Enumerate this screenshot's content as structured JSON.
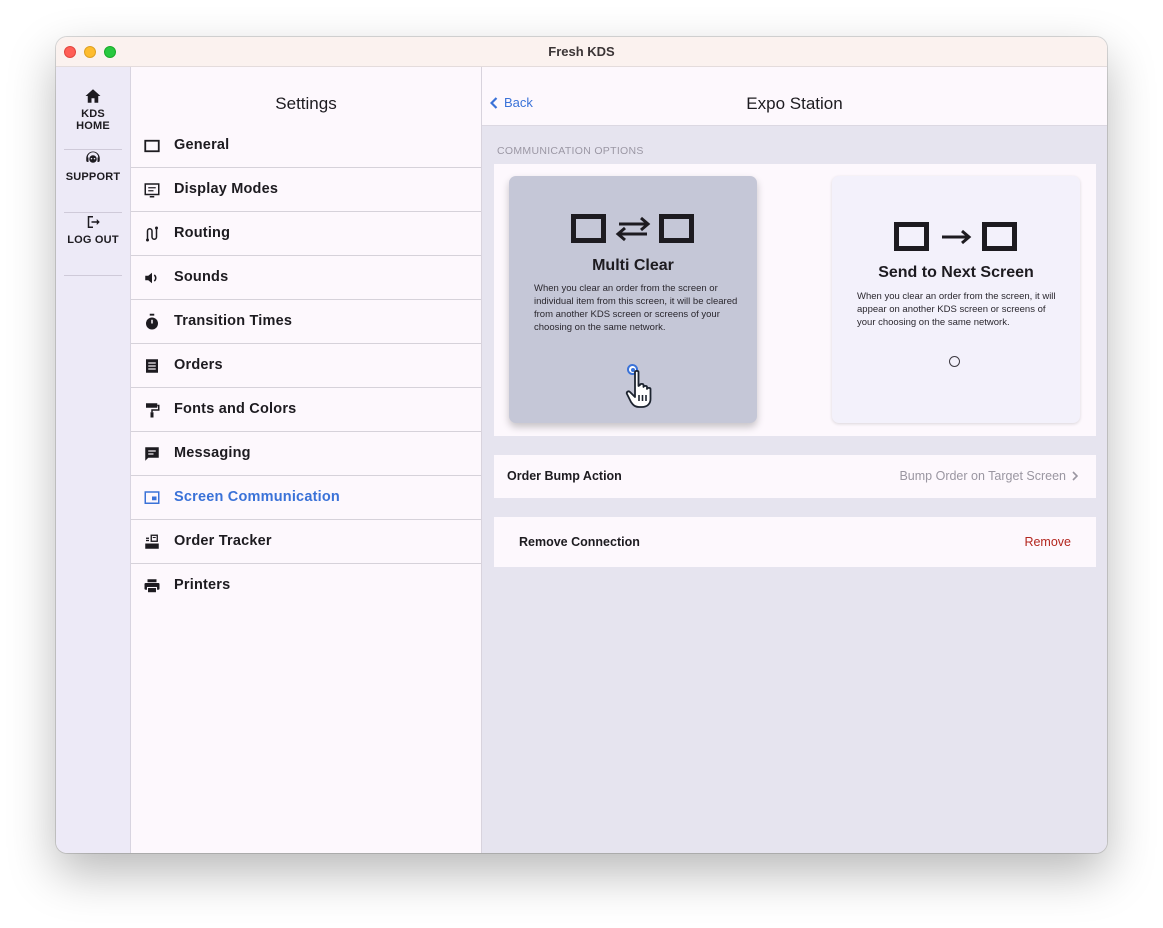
{
  "window": {
    "title": "Fresh KDS"
  },
  "rail": {
    "items": [
      {
        "label": "KDS HOME",
        "icon": "home-icon"
      },
      {
        "label": "SUPPORT",
        "icon": "support-icon"
      },
      {
        "label": "LOG OUT",
        "icon": "logout-icon"
      }
    ]
  },
  "settings": {
    "title": "Settings",
    "items": [
      {
        "label": "General",
        "icon": "general-icon"
      },
      {
        "label": "Display Modes",
        "icon": "display-modes-icon"
      },
      {
        "label": "Routing",
        "icon": "routing-icon"
      },
      {
        "label": "Sounds",
        "icon": "speaker-icon"
      },
      {
        "label": "Transition Times",
        "icon": "stopwatch-icon"
      },
      {
        "label": "Orders",
        "icon": "orders-icon"
      },
      {
        "label": "Fonts and Colors",
        "icon": "paint-roller-icon"
      },
      {
        "label": "Messaging",
        "icon": "message-icon"
      },
      {
        "label": "Screen Communication",
        "icon": "screen-communication-icon",
        "active": true
      },
      {
        "label": "Order Tracker",
        "icon": "order-tracker-icon"
      },
      {
        "label": "Printers",
        "icon": "printer-icon"
      }
    ]
  },
  "detail": {
    "back_label": "Back",
    "title": "Expo Station",
    "section_label": "COMMUNICATION OPTIONS",
    "options": [
      {
        "title": "Multi Clear",
        "description": "When you clear an order from the screen or individual item from this screen, it will be cleared from another KDS screen or screens of your choosing on the same network.",
        "selected": true,
        "icon": "two-way-arrows-icon"
      },
      {
        "title": "Send to Next Screen",
        "description": "When you clear an order from the screen, it will appear on another KDS screen or screens of your choosing on the same network.",
        "selected": false,
        "icon": "right-arrow-icon"
      }
    ],
    "bump_row": {
      "label": "Order Bump Action",
      "value": "Bump Order on Target Screen"
    },
    "remove_row": {
      "label": "Remove Connection",
      "action": "Remove"
    }
  },
  "colors": {
    "accent": "#3a72d8",
    "destructive": "#b3261e",
    "selected_card": "#c5c7d7",
    "detail_background": "#e6e4ef"
  }
}
